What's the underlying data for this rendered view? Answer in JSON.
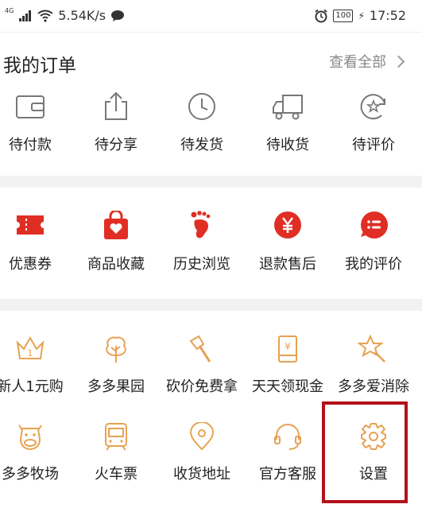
{
  "status_bar": {
    "network": "4G",
    "speed": "5.54K/s",
    "battery": "100",
    "time": "17:52"
  },
  "orders": {
    "title": "我的订单",
    "view_all": "查看全部",
    "items": [
      {
        "label": "待付款",
        "icon": "wallet-icon"
      },
      {
        "label": "待分享",
        "icon": "share-icon"
      },
      {
        "label": "待发货",
        "icon": "clock-icon"
      },
      {
        "label": "待收货",
        "icon": "truck-icon"
      },
      {
        "label": "待评价",
        "icon": "review-star-icon"
      }
    ]
  },
  "tools": {
    "items": [
      {
        "label": "优惠券",
        "icon": "coupon-icon"
      },
      {
        "label": "商品收藏",
        "icon": "favorite-bag-icon"
      },
      {
        "label": "历史浏览",
        "icon": "footprint-icon"
      },
      {
        "label": "退款售后",
        "icon": "yen-icon"
      },
      {
        "label": "我的评价",
        "icon": "comment-icon"
      }
    ]
  },
  "fun": {
    "row1": [
      {
        "label": "新人1元购",
        "icon": "crown-icon",
        "crown_digit": "1"
      },
      {
        "label": "多多果园",
        "icon": "tree-icon"
      },
      {
        "label": "砍价免费拿",
        "icon": "axe-icon"
      },
      {
        "label": "天天领现金",
        "icon": "cash-envelope-icon",
        "yen": "¥"
      },
      {
        "label": "多多爱消除",
        "icon": "star-wand-icon"
      }
    ],
    "row2": [
      {
        "label": "多多牧场",
        "icon": "cow-icon"
      },
      {
        "label": "火车票",
        "icon": "train-icon"
      },
      {
        "label": "收货地址",
        "icon": "location-pin-icon"
      },
      {
        "label": "官方客服",
        "icon": "headset-icon"
      },
      {
        "label": "设置",
        "icon": "gear-icon"
      }
    ]
  },
  "colors": {
    "red": "#e02e24",
    "orange": "#e8a152",
    "gray_icon": "#777777",
    "highlight": "#b3121a"
  }
}
